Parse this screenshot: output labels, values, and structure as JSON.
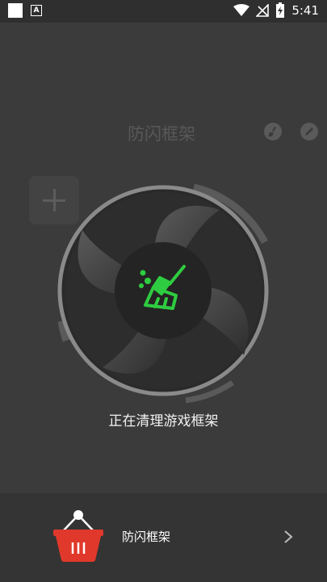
{
  "status_bar": {
    "time": "5:41",
    "left_icons": [
      "notification-square-icon",
      "font-a-icon"
    ],
    "right_icons": [
      "wifi-icon",
      "no-signal-icon",
      "battery-charging-icon"
    ]
  },
  "header": {
    "title": "防闪框架",
    "icons": [
      "broom-icon",
      "pencil-icon"
    ]
  },
  "add_button": {
    "icon": "plus-icon"
  },
  "fan": {
    "center_icon": "broom-icon",
    "accent_color": "#2ecc40"
  },
  "status": {
    "text": "正在清理游戏框架"
  },
  "bottom_item": {
    "label": "防闪框架",
    "icon": "shopping-basket-icon",
    "basket_color": "#e0392b",
    "chevron": "chevron-right-icon"
  }
}
